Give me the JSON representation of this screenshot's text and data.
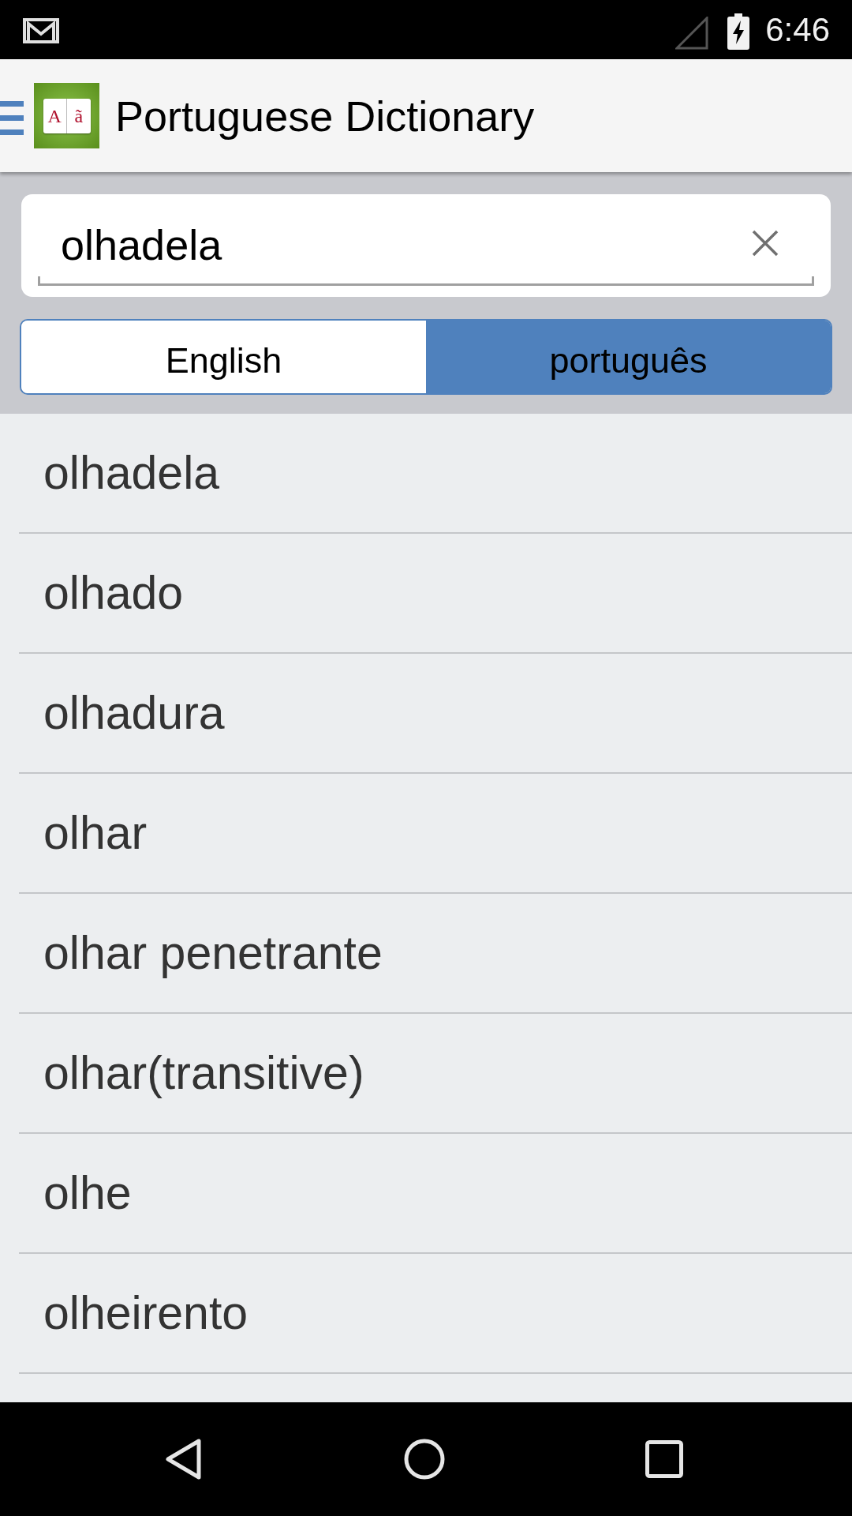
{
  "status_bar": {
    "time": "6:46"
  },
  "app_bar": {
    "logo_letters": [
      "A",
      "ã"
    ],
    "title": "Portuguese Dictionary"
  },
  "search": {
    "value": "olhadela"
  },
  "language_toggle": [
    {
      "label": "English",
      "selected": false
    },
    {
      "label": "português",
      "selected": true
    }
  ],
  "results": [
    "olhadela",
    "olhado",
    "olhadura",
    "olhar",
    "olhar penetrante",
    "olhar(transitive)",
    "olhe",
    "olheirento"
  ]
}
